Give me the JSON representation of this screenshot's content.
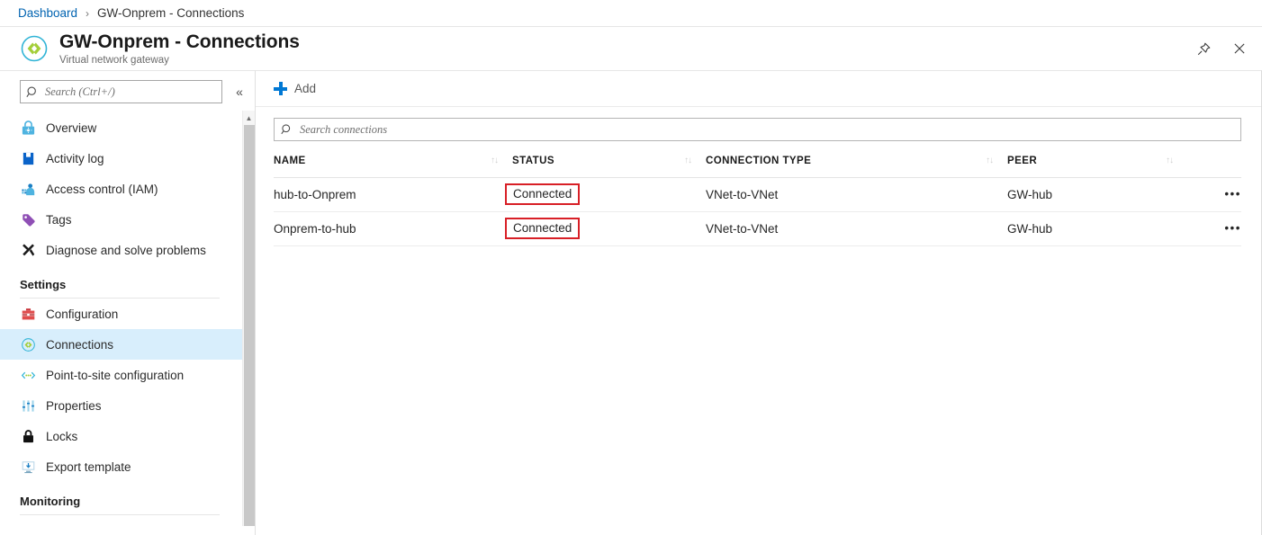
{
  "breadcrumb": {
    "root": "Dashboard",
    "separator": "›",
    "current": "GW-Onprem - Connections"
  },
  "header": {
    "title": "GW-Onprem - Connections",
    "subtitle": "Virtual network gateway",
    "logo_icon": "virtual-network-gateway-icon",
    "pin_icon": "pin-icon",
    "close_icon": "close-icon"
  },
  "sidebar": {
    "search": {
      "placeholder": "Search (Ctrl+/)",
      "value": "",
      "icon": "search-icon"
    },
    "collapse_icon": "«",
    "items": [
      {
        "label": "Overview",
        "icon": "overview-icon",
        "selected": false
      },
      {
        "label": "Activity log",
        "icon": "activity-log-icon",
        "selected": false
      },
      {
        "label": "Access control (IAM)",
        "icon": "access-control-icon",
        "selected": false
      },
      {
        "label": "Tags",
        "icon": "tags-icon",
        "selected": false
      },
      {
        "label": "Diagnose and solve problems",
        "icon": "diagnose-icon",
        "selected": false
      }
    ],
    "sections": [
      {
        "title": "Settings",
        "items": [
          {
            "label": "Configuration",
            "icon": "configuration-icon",
            "selected": false
          },
          {
            "label": "Connections",
            "icon": "connections-icon",
            "selected": true
          },
          {
            "label": "Point-to-site configuration",
            "icon": "point-to-site-icon",
            "selected": false
          },
          {
            "label": "Properties",
            "icon": "properties-icon",
            "selected": false
          },
          {
            "label": "Locks",
            "icon": "locks-icon",
            "selected": false
          },
          {
            "label": "Export template",
            "icon": "export-template-icon",
            "selected": false
          }
        ]
      },
      {
        "title": "Monitoring",
        "items": []
      }
    ]
  },
  "toolbar": {
    "add_label": "Add",
    "add_icon": "plus-icon"
  },
  "main": {
    "search": {
      "placeholder": "Search connections",
      "value": "",
      "icon": "search-icon"
    },
    "table": {
      "columns": [
        {
          "label": "NAME",
          "sortable": true
        },
        {
          "label": "STATUS",
          "sortable": true
        },
        {
          "label": "CONNECTION TYPE",
          "sortable": true
        },
        {
          "label": "PEER",
          "sortable": true
        }
      ],
      "sort_glyph": "↑↓",
      "row_menu_glyph": "•••",
      "rows": [
        {
          "name": "hub-to-Onprem",
          "status": "Connected",
          "status_highlighted": true,
          "connection_type": "VNet-to-VNet",
          "peer": "GW-hub"
        },
        {
          "name": "Onprem-to-hub",
          "status": "Connected",
          "status_highlighted": true,
          "connection_type": "VNet-to-VNet",
          "peer": "GW-hub"
        }
      ]
    }
  },
  "colors": {
    "accent_blue": "#0078d4",
    "link_blue": "#0063b1",
    "selected_row": "#d8eefc",
    "highlight_red": "#d81f26",
    "gateway_cyan": "#30b4d6",
    "gateway_green": "#a4ce39"
  }
}
